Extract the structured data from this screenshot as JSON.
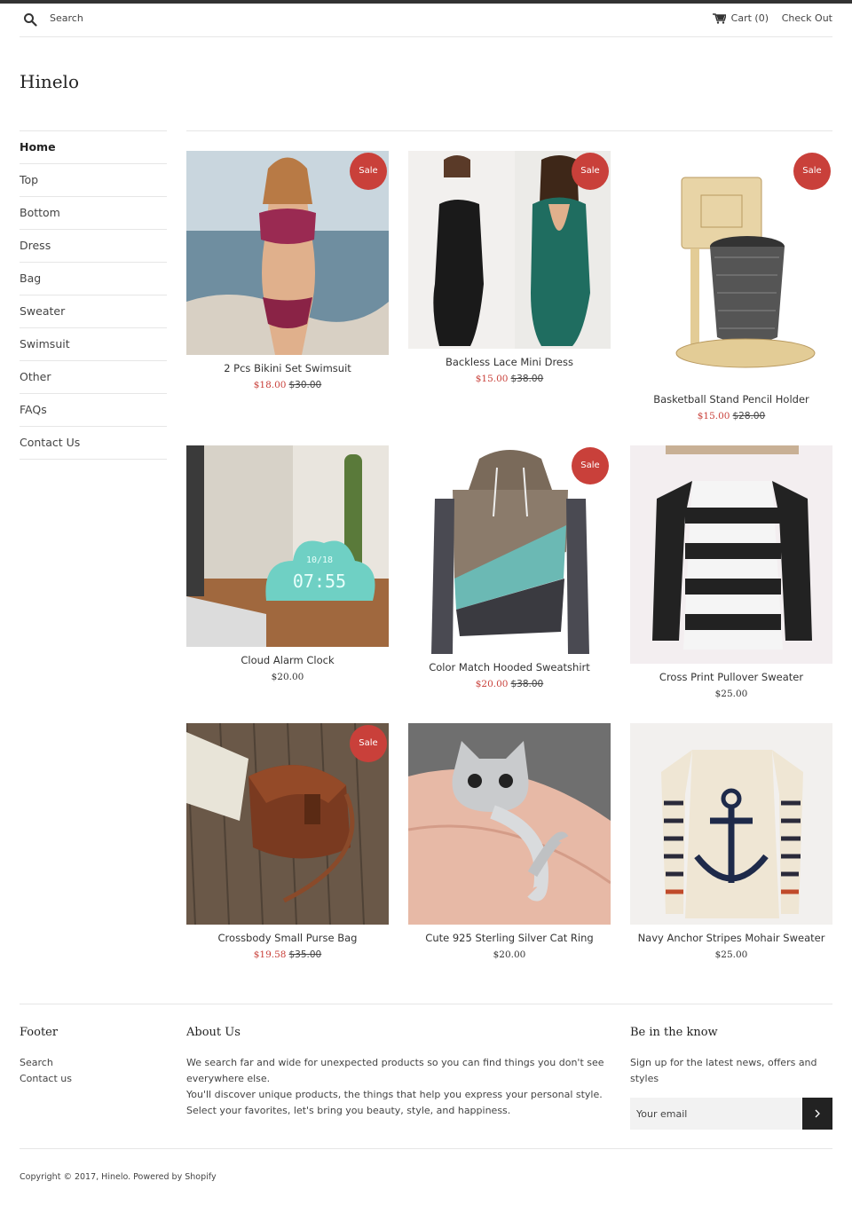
{
  "header": {
    "search_label": "Search",
    "cart_label": "Cart (0)",
    "checkout_label": "Check Out"
  },
  "logo": "Hinelo",
  "nav": [
    "Home",
    "Top",
    "Bottom",
    "Dress",
    "Bag",
    "Sweater",
    "Swimsuit",
    "Other",
    "FAQs",
    "Contact Us"
  ],
  "sale_badge": "Sale",
  "products": [
    {
      "title": "2 Pcs Bikini Set Swimsuit",
      "price": "$18.00",
      "was": "$30.00"
    },
    {
      "title": "Backless Lace Mini Dress",
      "price": "$15.00",
      "was": "$38.00"
    },
    {
      "title": "Basketball Stand Pencil Holder",
      "price": "$15.00",
      "was": "$28.00"
    },
    {
      "title": "Cloud Alarm Clock",
      "price": "$20.00",
      "was": ""
    },
    {
      "title": "Color Match Hooded Sweatshirt",
      "price": "$20.00",
      "was": "$38.00"
    },
    {
      "title": "Cross Print Pullover Sweater",
      "price": "$25.00",
      "was": ""
    },
    {
      "title": "Crossbody Small Purse Bag",
      "price": "$19.58",
      "was": "$35.00"
    },
    {
      "title": "Cute 925 Sterling Silver Cat Ring",
      "price": "$20.00",
      "was": ""
    },
    {
      "title": "Navy Anchor Stripes Mohair Sweater",
      "price": "$25.00",
      "was": ""
    }
  ],
  "clock_date": "10/18",
  "clock_time": "07:55",
  "footer": {
    "col1_title": "Footer",
    "col1_links": [
      "Search",
      "Contact us"
    ],
    "about_title": "About Us",
    "about_lines": [
      "We search far and wide for unexpected products so you can find things you don't see",
      "everywhere else.",
      "You'll discover unique products, the things that help you express your personal style.",
      "Select your favorites, let's bring you beauty, style, and happiness."
    ],
    "newsletter_title": "Be in the know",
    "newsletter_text": "Sign up for the latest news, offers and styles",
    "email_placeholder": "Your email"
  },
  "copyright": "Copyright © 2017, Hinelo. Powered by Shopify",
  "colors": {
    "sale": "#c9403a",
    "topbar": "#333333"
  }
}
